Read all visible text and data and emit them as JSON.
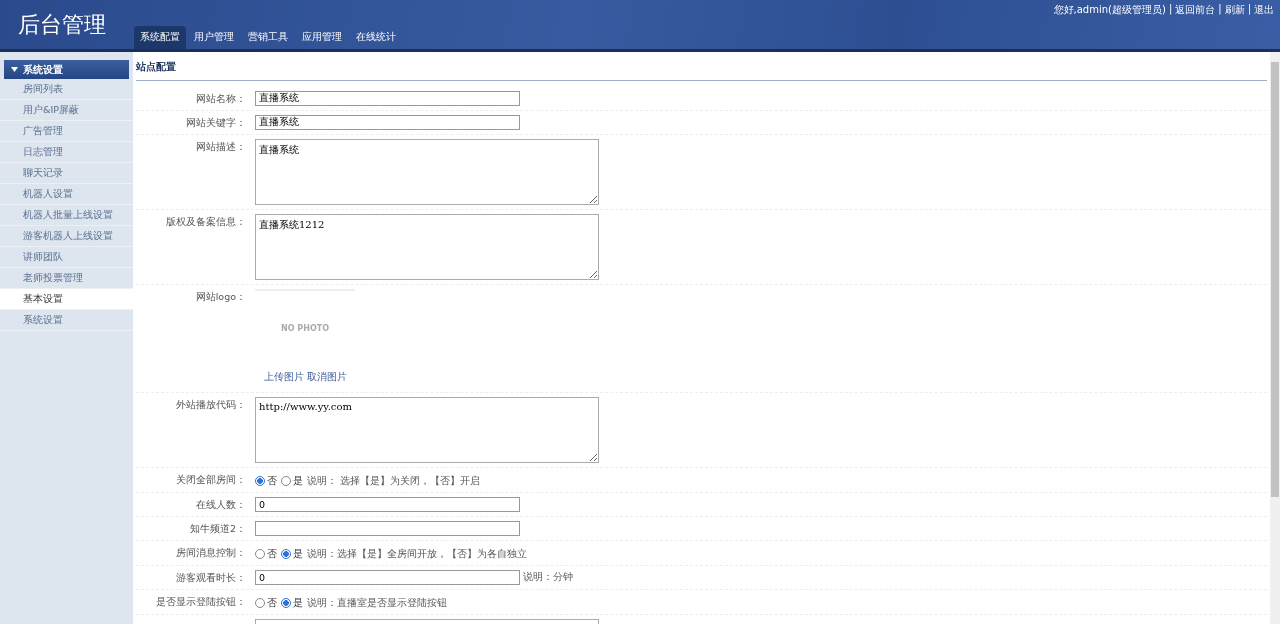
{
  "header": {
    "title": "后台管理",
    "nav": [
      {
        "label": "系统配置",
        "selected": true
      },
      {
        "label": "用户管理",
        "selected": false
      },
      {
        "label": "营销工具",
        "selected": false
      },
      {
        "label": "应用管理",
        "selected": false
      },
      {
        "label": "在线统计",
        "selected": false
      }
    ],
    "user_links": [
      "您好,admin(超级管理员)",
      "返回前台",
      "刷新",
      "退出"
    ],
    "separator": "|"
  },
  "sidebar": {
    "group": {
      "label": "系统设置",
      "expanded": true
    },
    "items": [
      {
        "label": "房间列表",
        "selected": false
      },
      {
        "label": "用户&IP屏蔽",
        "selected": false
      },
      {
        "label": "广告管理",
        "selected": false
      },
      {
        "label": "日志管理",
        "selected": false
      },
      {
        "label": "聊天记录",
        "selected": false
      },
      {
        "label": "机器人设置",
        "selected": false
      },
      {
        "label": "机器人批量上线设置",
        "selected": false
      },
      {
        "label": "游客机器人上线设置",
        "selected": false
      },
      {
        "label": "讲师团队",
        "selected": false
      },
      {
        "label": "老师投票管理",
        "selected": false
      },
      {
        "label": "基本设置",
        "selected": true
      },
      {
        "label": "系统设置",
        "selected": false
      }
    ]
  },
  "panel": {
    "title": "站点配置",
    "fields": [
      {
        "kind": "text",
        "label": "网站名称：",
        "value": "直播系统"
      },
      {
        "kind": "text",
        "label": "网站关键字：",
        "value": "直播系统"
      },
      {
        "kind": "textarea",
        "label": "网站描述：",
        "value": "直播系统"
      },
      {
        "kind": "textarea",
        "label": "版权及备案信息：",
        "value": "直播系统1212"
      },
      {
        "kind": "logo",
        "label": "网站logo：",
        "photo_text": "NO PHOTO",
        "links": [
          "上传图片",
          "取消图片"
        ]
      },
      {
        "kind": "textarea",
        "label": "外站播放代码：",
        "value": "http://www.yy.com"
      },
      {
        "kind": "radio",
        "label": "关闭全部房间：",
        "options": [
          {
            "label": "否",
            "selected": true
          },
          {
            "label": "是",
            "selected": false
          }
        ],
        "note": "说明：   选择【是】为关闭，【否】开启"
      },
      {
        "kind": "text",
        "label": "在线人数：",
        "value": "0"
      },
      {
        "kind": "text",
        "label": "知牛频道2："
      },
      {
        "kind": "radio",
        "label": "房间消息控制：",
        "options": [
          {
            "label": "否",
            "selected": false
          },
          {
            "label": "是",
            "selected": true
          }
        ],
        "note": "说明：选择【是】全房间开放，【否】为各自独立"
      },
      {
        "kind": "text",
        "label": "游客观看时长：",
        "value": "0",
        "note": "说明：分钟"
      },
      {
        "kind": "radio",
        "label": "是否显示登陆按钮：",
        "options": [
          {
            "label": "否",
            "selected": false
          },
          {
            "label": "是",
            "selected": true
          }
        ],
        "note": "说明：直播室是否显示登陆按钮"
      },
      {
        "kind": "textarea"
      }
    ]
  }
}
